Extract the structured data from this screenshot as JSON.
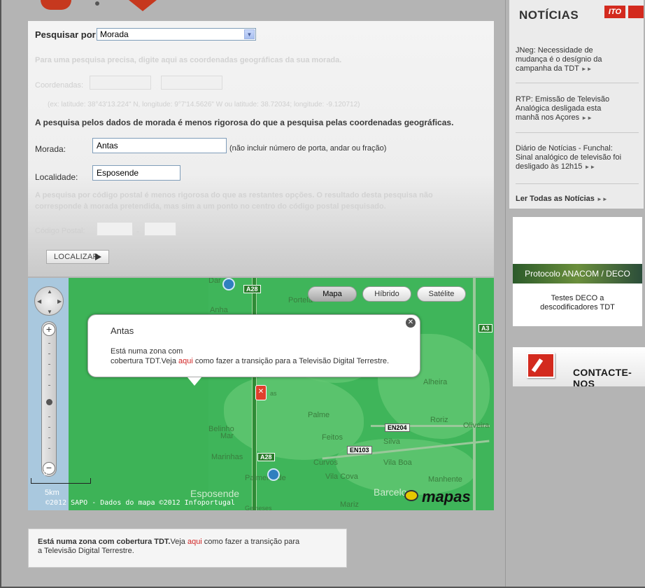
{
  "form": {
    "search_by_label": "Pesquisar por",
    "search_by_value": "Morada",
    "coords_hint": "Para uma pesquisa precisa, digite aqui as coordenadas geográficas da sua morada.",
    "coords_label": "Coordenadas:",
    "coords_example": "(ex: latitude: 38°43'13.224\" N, longitude: 9°7'14.5626\" W ou latitude: 38.72034; longitude: -9.120712)",
    "address_note": "A pesquisa pelos dados de morada é menos rigorosa do que a pesquisa pelas coordenadas geográficas.",
    "morada_label": "Morada:",
    "morada_value": "Antas",
    "morada_note": "(não incluir número de porta, andar ou fração)",
    "localidade_label": "Localidade:",
    "localidade_value": "Esposende",
    "postal_note_line1": "A pesquisa por código postal é menos rigorosa do que as restantes opções. O resultado desta pesquisa não",
    "postal_note_line2": "corresponde à morada pretendida, mas sim a um ponto no centro do código postal pesquisado.",
    "postal_label": "Código Postal:",
    "postal_sep": "-",
    "localizar_label": "LOCALIZAR"
  },
  "map": {
    "type_buttons": [
      "Mapa",
      "Híbrido",
      "Satélite"
    ],
    "active_type": "Mapa",
    "popup_title": "Antas",
    "popup_line1": "Está numa zona com",
    "popup_line2_pre": "cobertura TDT.Veja ",
    "popup_link": "aqui",
    "popup_line2_post": " como fazer a transição para a Televisão Digital Terrestre.",
    "scale_label": "5km",
    "scale_zero": "0",
    "copyright": "©2012 SAPO - Dados do mapa ©2012 Infoportugal",
    "logo": "mapas",
    "towns": {
      "esposende": "Esposende",
      "barcelos": "Barcelos",
      "anha": "Anha",
      "belinho": "Belinho",
      "marinhas": "Marinhas",
      "palmeira": "Palmeira de",
      "vila_cova": "Vila Cova",
      "curvos": "Curvos",
      "alheira": "Alheira",
      "roriz": "Roriz",
      "oliveira": "Oliveira",
      "manhente": "Manhente",
      "vila_boa": "Vila Boa",
      "gemeses": "Gemeses",
      "mariz": "Mariz",
      "silva": "Silva",
      "feitos": "Feitos",
      "palme": "Palme",
      "mar": "Mar",
      "portela": "Portela",
      "dar": "Dar",
      "as": "as"
    },
    "roads": {
      "a28_top": "A28",
      "a28_bottom": "A28",
      "a3": "A3",
      "en204": "EN204",
      "en103": "EN103"
    }
  },
  "bottom_box": {
    "bold": "Está numa zona com cobertura TDT.",
    "pre": "Veja ",
    "link": "aqui",
    "post": " como fazer a transição para",
    "line2": "a Televisão Digital Terrestre."
  },
  "news": {
    "title": "NOTÍCIAS",
    "badge": "ITO",
    "items": [
      {
        "line1": "JNeg: Necessidade de",
        "line2": "mudança é o desígnio da",
        "line3": "campanha da TDT"
      },
      {
        "line1": "RTP: Emissão de Televisão",
        "line2": "Analógica desligada esta",
        "line3": "manhã nos Açores"
      },
      {
        "line1": "Diário de Notícias - Funchal:",
        "line2": "Sinal analógico de televisão foi",
        "line3": "desligado às 12h15"
      }
    ],
    "arrows": "►►",
    "read_all": "Ler Todas as Notícias"
  },
  "deco_ad": {
    "band": "Protocolo ANACOM / DECO",
    "line1": "Testes DECO a",
    "line2": "descodificadores TDT"
  },
  "contact": {
    "label": "CONTACTE-NOS"
  }
}
